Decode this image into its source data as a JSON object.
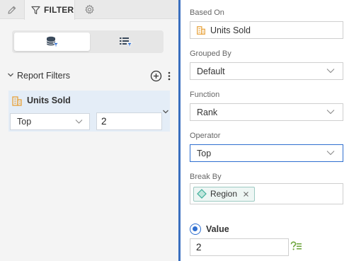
{
  "toolbar": {
    "edit_icon": "pencil-icon",
    "filter_tab_label": "FILTER",
    "settings_icon": "gear-icon"
  },
  "view_toggle": {
    "left_icon": "database-filter-icon",
    "right_icon": "list-filter-icon",
    "active": "left"
  },
  "report_filters": {
    "title": "Report Filters",
    "add_icon": "plus-circle-icon",
    "more_icon": "more-vertical-icon",
    "filter": {
      "measure": "Units Sold",
      "operator": "Top",
      "value": "2"
    }
  },
  "panel": {
    "based_on": {
      "label": "Based On",
      "value": "Units Sold"
    },
    "grouped_by": {
      "label": "Grouped By",
      "value": "Default"
    },
    "function": {
      "label": "Function",
      "value": "Rank"
    },
    "operator": {
      "label": "Operator",
      "value": "Top"
    },
    "break_by": {
      "label": "Break By",
      "chip": "Region"
    },
    "value": {
      "label": "Value",
      "input": "2",
      "help_icon": "formula-help-icon"
    }
  },
  "colors": {
    "accent": "#2f6fd0",
    "divider": "#3a6fbf",
    "measure_icon": "#e8a23a",
    "dimension_icon": "#3fae9a",
    "card_bg": "#e4edf7"
  }
}
